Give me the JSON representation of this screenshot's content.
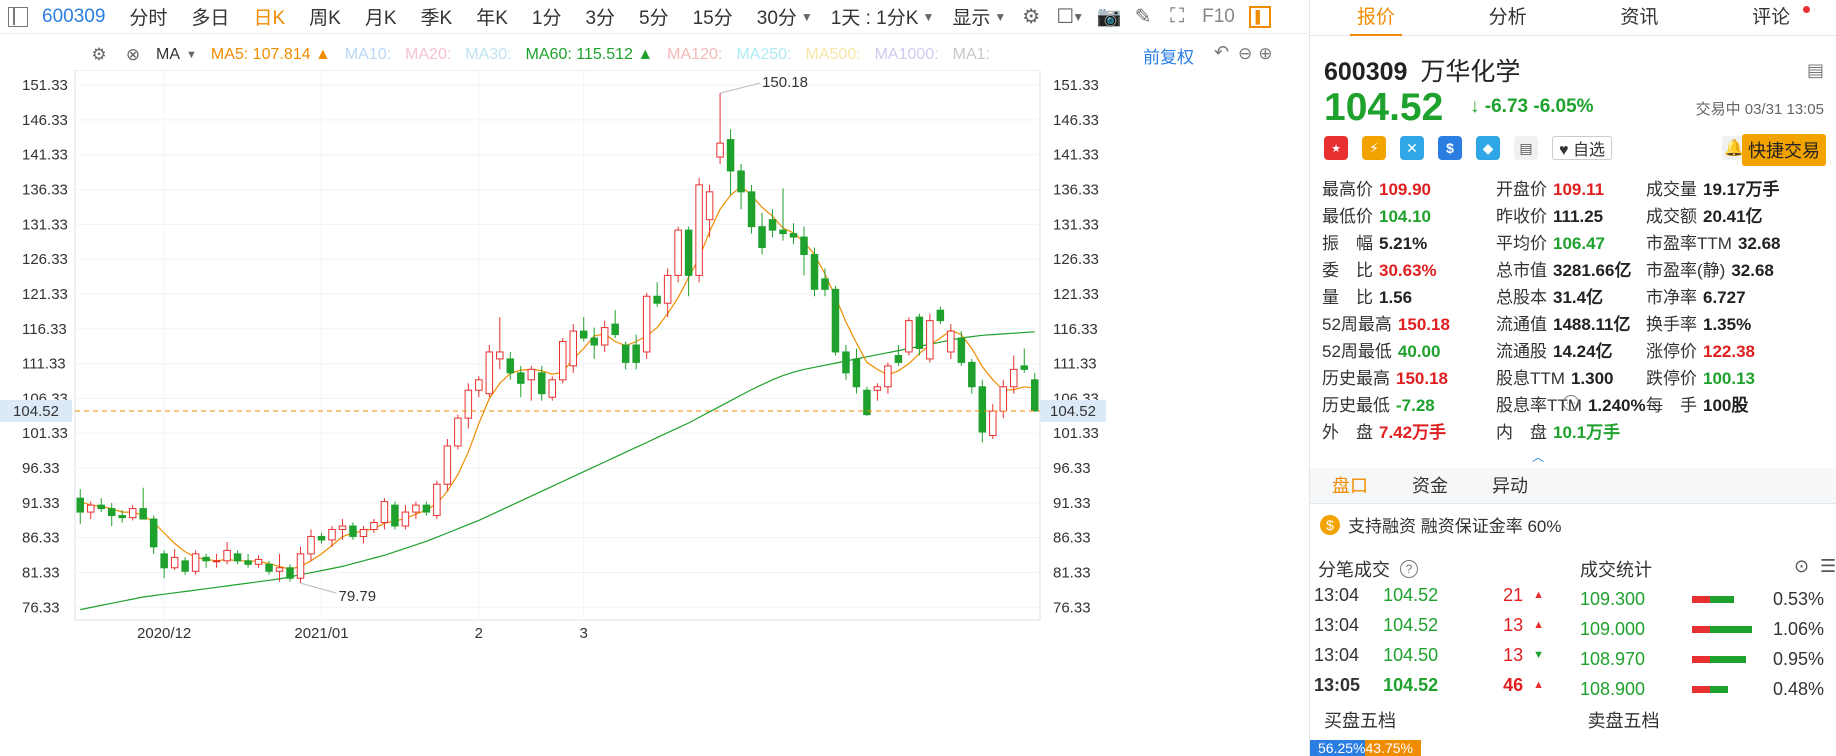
{
  "toolbar": {
    "code": "600309",
    "periods": [
      "分时",
      "多日",
      "日K",
      "周K",
      "月K",
      "季K",
      "年K",
      "1分",
      "3分",
      "5分",
      "15分",
      "30分"
    ],
    "active_period": "日K",
    "interval_select": "1天 : 1分K",
    "display_label": "显示",
    "f10_label": "F10"
  },
  "ma_row": {
    "label": "MA",
    "items": [
      {
        "text": "MA5: 107.814 ▲",
        "color": "#f08c00"
      },
      {
        "text": "MA10:",
        "color": "#b9d7f5"
      },
      {
        "text": "MA20:",
        "color": "#f4c2d8"
      },
      {
        "text": "MA30:",
        "color": "#bfe3ef"
      },
      {
        "text": "MA60: 115.512 ▲",
        "color": "#1fa12d"
      },
      {
        "text": "MA120:",
        "color": "#f5b8b8"
      },
      {
        "text": "MA250:",
        "color": "#aeeaf5"
      },
      {
        "text": "MA500:",
        "color": "#f5e6a8"
      },
      {
        "text": "MA1000:",
        "color": "#d4c8f0"
      },
      {
        "text": "MA1:",
        "color": "#c8c8c8"
      }
    ],
    "adjust_label": "前复权"
  },
  "chart_data": {
    "type": "candlestick",
    "y_ticks": [
      "151.33",
      "146.33",
      "141.33",
      "136.33",
      "131.33",
      "126.33",
      "121.33",
      "116.33",
      "111.33",
      "106.33",
      "101.33",
      "96.33",
      "91.33",
      "86.33",
      "81.33",
      "76.33"
    ],
    "ylim": [
      74.5,
      153.5
    ],
    "x_labels": [
      {
        "text": "2020/12",
        "index": 8
      },
      {
        "text": "2021/01",
        "index": 23
      },
      {
        "text": "2",
        "index": 38
      },
      {
        "text": "3",
        "index": 48
      }
    ],
    "current_price_label": "104.52",
    "current_price": 104.52,
    "high_annotation": "150.18",
    "low_annotation": "79.79",
    "candles": [
      {
        "o": 92.0,
        "h": 93.3,
        "l": 88.3,
        "c": 90.0
      },
      {
        "o": 90.0,
        "h": 91.5,
        "l": 89.0,
        "c": 91.0
      },
      {
        "o": 91.0,
        "h": 92.0,
        "l": 90.0,
        "c": 90.5
      },
      {
        "o": 90.5,
        "h": 91.3,
        "l": 88.0,
        "c": 89.5
      },
      {
        "o": 89.5,
        "h": 90.3,
        "l": 88.5,
        "c": 89.2
      },
      {
        "o": 89.2,
        "h": 91.0,
        "l": 88.8,
        "c": 90.5
      },
      {
        "o": 90.5,
        "h": 93.5,
        "l": 89.0,
        "c": 89.0
      },
      {
        "o": 89.0,
        "h": 89.5,
        "l": 84.0,
        "c": 85.0
      },
      {
        "o": 84.0,
        "h": 84.5,
        "l": 80.5,
        "c": 82.0
      },
      {
        "o": 82.0,
        "h": 84.7,
        "l": 81.7,
        "c": 83.5
      },
      {
        "o": 83.0,
        "h": 83.5,
        "l": 81.0,
        "c": 81.5
      },
      {
        "o": 81.5,
        "h": 84.5,
        "l": 81.0,
        "c": 84.0
      },
      {
        "o": 83.5,
        "h": 84.0,
        "l": 82.0,
        "c": 83.0
      },
      {
        "o": 83.0,
        "h": 84.0,
        "l": 82.0,
        "c": 83.0
      },
      {
        "o": 83.0,
        "h": 85.7,
        "l": 82.5,
        "c": 84.5
      },
      {
        "o": 84.0,
        "h": 84.5,
        "l": 82.5,
        "c": 83.0
      },
      {
        "o": 83.0,
        "h": 84.0,
        "l": 82.0,
        "c": 82.5
      },
      {
        "o": 82.5,
        "h": 83.8,
        "l": 82.0,
        "c": 83.2
      },
      {
        "o": 82.5,
        "h": 83.0,
        "l": 81.0,
        "c": 81.5
      },
      {
        "o": 81.5,
        "h": 84.0,
        "l": 80.0,
        "c": 82.0
      },
      {
        "o": 82.0,
        "h": 82.5,
        "l": 80.0,
        "c": 80.5
      },
      {
        "o": 80.5,
        "h": 85.0,
        "l": 79.8,
        "c": 84.0
      },
      {
        "o": 84.0,
        "h": 87.5,
        "l": 83.0,
        "c": 86.5
      },
      {
        "o": 86.5,
        "h": 87.0,
        "l": 85.5,
        "c": 86.0
      },
      {
        "o": 86.0,
        "h": 88.0,
        "l": 85.0,
        "c": 87.5
      },
      {
        "o": 87.5,
        "h": 89.0,
        "l": 86.0,
        "c": 88.0
      },
      {
        "o": 88.0,
        "h": 88.5,
        "l": 86.0,
        "c": 86.5
      },
      {
        "o": 86.5,
        "h": 88.0,
        "l": 85.5,
        "c": 87.5
      },
      {
        "o": 87.5,
        "h": 89.0,
        "l": 87.0,
        "c": 88.5
      },
      {
        "o": 88.5,
        "h": 92.0,
        "l": 87.5,
        "c": 91.5
      },
      {
        "o": 91.0,
        "h": 91.5,
        "l": 87.5,
        "c": 88.0
      },
      {
        "o": 88.0,
        "h": 91.0,
        "l": 87.5,
        "c": 90.0
      },
      {
        "o": 90.0,
        "h": 91.5,
        "l": 89.0,
        "c": 91.0
      },
      {
        "o": 91.0,
        "h": 91.5,
        "l": 89.5,
        "c": 90.0
      },
      {
        "o": 89.5,
        "h": 94.5,
        "l": 89.0,
        "c": 94.0
      },
      {
        "o": 94.0,
        "h": 100.5,
        "l": 93.0,
        "c": 99.5
      },
      {
        "o": 99.5,
        "h": 104.0,
        "l": 99.0,
        "c": 103.5
      },
      {
        "o": 103.5,
        "h": 108.5,
        "l": 102.0,
        "c": 107.5
      },
      {
        "o": 107.5,
        "h": 109.5,
        "l": 106.5,
        "c": 109.0
      },
      {
        "o": 107.0,
        "h": 114.0,
        "l": 106.5,
        "c": 113.0
      },
      {
        "o": 112.0,
        "h": 118.0,
        "l": 110.5,
        "c": 113.0
      },
      {
        "o": 112.0,
        "h": 113.0,
        "l": 109.0,
        "c": 110.0
      },
      {
        "o": 110.0,
        "h": 111.0,
        "l": 106.5,
        "c": 108.5
      },
      {
        "o": 109.0,
        "h": 111.0,
        "l": 106.0,
        "c": 110.5
      },
      {
        "o": 110.0,
        "h": 111.0,
        "l": 106.0,
        "c": 107.0
      },
      {
        "o": 106.5,
        "h": 109.5,
        "l": 106.0,
        "c": 109.0
      },
      {
        "o": 109.0,
        "h": 115.0,
        "l": 108.5,
        "c": 114.5
      },
      {
        "o": 111.0,
        "h": 117.0,
        "l": 110.0,
        "c": 116.0
      },
      {
        "o": 116.0,
        "h": 118.0,
        "l": 114.5,
        "c": 115.0
      },
      {
        "o": 115.0,
        "h": 116.5,
        "l": 112.0,
        "c": 114.0
      },
      {
        "o": 114.0,
        "h": 117.5,
        "l": 113.0,
        "c": 116.5
      },
      {
        "o": 117.0,
        "h": 119.0,
        "l": 115.0,
        "c": 115.5
      },
      {
        "o": 114.0,
        "h": 114.5,
        "l": 110.5,
        "c": 111.5
      },
      {
        "o": 114.0,
        "h": 115.5,
        "l": 110.5,
        "c": 111.5
      },
      {
        "o": 113.0,
        "h": 121.5,
        "l": 112.0,
        "c": 121.0
      },
      {
        "o": 121.0,
        "h": 123.0,
        "l": 119.5,
        "c": 120.0
      },
      {
        "o": 120.0,
        "h": 125.0,
        "l": 118.0,
        "c": 124.0
      },
      {
        "o": 124.0,
        "h": 131.0,
        "l": 123.0,
        "c": 130.5
      },
      {
        "o": 130.5,
        "h": 131.0,
        "l": 121.0,
        "c": 124.0
      },
      {
        "o": 124.0,
        "h": 138.0,
        "l": 123.0,
        "c": 137.0
      },
      {
        "o": 132.0,
        "h": 137.0,
        "l": 129.5,
        "c": 136.0
      },
      {
        "o": 141.0,
        "h": 150.18,
        "l": 140.0,
        "c": 143.0
      },
      {
        "o": 143.5,
        "h": 145.0,
        "l": 135.5,
        "c": 139.0
      },
      {
        "o": 139.0,
        "h": 140.0,
        "l": 133.5,
        "c": 136.0
      },
      {
        "o": 136.0,
        "h": 137.0,
        "l": 130.0,
        "c": 131.0
      },
      {
        "o": 131.0,
        "h": 133.0,
        "l": 127.0,
        "c": 128.0
      },
      {
        "o": 132.0,
        "h": 133.5,
        "l": 129.5,
        "c": 130.5
      },
      {
        "o": 130.5,
        "h": 136.5,
        "l": 129.0,
        "c": 130.0
      },
      {
        "o": 130.0,
        "h": 131.5,
        "l": 128.5,
        "c": 129.5
      },
      {
        "o": 129.5,
        "h": 131.0,
        "l": 124.0,
        "c": 127.0
      },
      {
        "o": 127.0,
        "h": 128.0,
        "l": 121.0,
        "c": 122.0
      },
      {
        "o": 123.5,
        "h": 125.0,
        "l": 121.0,
        "c": 122.0
      },
      {
        "o": 122.0,
        "h": 122.5,
        "l": 112.5,
        "c": 113.0
      },
      {
        "o": 113.0,
        "h": 114.0,
        "l": 109.0,
        "c": 110.0
      },
      {
        "o": 112.0,
        "h": 113.5,
        "l": 107.0,
        "c": 108.0
      },
      {
        "o": 107.5,
        "h": 108.0,
        "l": 103.8,
        "c": 104.0
      },
      {
        "o": 107.5,
        "h": 108.5,
        "l": 106.0,
        "c": 108.0
      },
      {
        "o": 108.0,
        "h": 111.5,
        "l": 107.0,
        "c": 111.0
      },
      {
        "o": 112.5,
        "h": 114.0,
        "l": 111.0,
        "c": 111.5
      },
      {
        "o": 113.0,
        "h": 118.0,
        "l": 112.5,
        "c": 117.5
      },
      {
        "o": 118.0,
        "h": 118.5,
        "l": 112.5,
        "c": 113.5
      },
      {
        "o": 112.0,
        "h": 118.5,
        "l": 111.5,
        "c": 117.5
      },
      {
        "o": 119.0,
        "h": 119.5,
        "l": 117.0,
        "c": 117.5
      },
      {
        "o": 113.0,
        "h": 117.0,
        "l": 112.0,
        "c": 116.0
      },
      {
        "o": 115.0,
        "h": 116.0,
        "l": 111.0,
        "c": 111.5
      },
      {
        "o": 111.5,
        "h": 112.0,
        "l": 107.0,
        "c": 108.0
      },
      {
        "o": 108.0,
        "h": 109.0,
        "l": 100.0,
        "c": 101.5
      },
      {
        "o": 101.0,
        "h": 105.5,
        "l": 100.5,
        "c": 104.5
      },
      {
        "o": 104.5,
        "h": 109.0,
        "l": 103.5,
        "c": 108.0
      },
      {
        "o": 108.0,
        "h": 112.5,
        "l": 107.0,
        "c": 110.5
      },
      {
        "o": 111.0,
        "h": 113.5,
        "l": 110.0,
        "c": 110.5
      },
      {
        "o": 109.0,
        "h": 110.0,
        "l": 104.4,
        "c": 104.52
      }
    ],
    "ma5": [
      91.5,
      91.0,
      90.8,
      90.5,
      90.0,
      90.0,
      89.5,
      88.5,
      87.0,
      85.5,
      84.3,
      83.5,
      83.2,
      83.0,
      83.2,
      83.0,
      83.0,
      82.9,
      82.6,
      82.2,
      81.8,
      82.2,
      83.0,
      84.0,
      85.2,
      86.5,
      87.0,
      87.3,
      87.6,
      88.4,
      88.7,
      89.1,
      89.7,
      90.3,
      91.2,
      93.0,
      95.4,
      98.6,
      102.7,
      106.3,
      108.5,
      109.9,
      110.4,
      110.5,
      110.3,
      109.8,
      110.1,
      112.0,
      113.5,
      115.3,
      115.6,
      114.5,
      113.9,
      114.5,
      115.3,
      116.5,
      118.5,
      120.8,
      123.7,
      126.5,
      130.3,
      133.5,
      135.5,
      136.8,
      135.5,
      133.8,
      132.5,
      130.8,
      130.1,
      128.8,
      127.0,
      124.2,
      120.9,
      117.3,
      114.3,
      111.5,
      110.5,
      109.7,
      110.3,
      111.3,
      112.8,
      114.0,
      115.0,
      116.1,
      115.5,
      113.5,
      110.9,
      109.0,
      107.5,
      107.6,
      108.0,
      107.8
    ],
    "ma60": [
      76.0,
      76.3,
      76.6,
      76.9,
      77.2,
      77.5,
      77.8,
      78.0,
      78.2,
      78.4,
      78.6,
      78.8,
      79.0,
      79.2,
      79.4,
      79.6,
      79.8,
      80.0,
      80.2,
      80.4,
      80.7,
      81.0,
      81.3,
      81.6,
      81.9,
      82.2,
      82.6,
      83.0,
      83.4,
      83.8,
      84.3,
      84.8,
      85.3,
      85.8,
      86.4,
      87.0,
      87.6,
      88.2,
      88.8,
      89.5,
      90.2,
      90.9,
      91.6,
      92.3,
      93.0,
      93.7,
      94.4,
      95.1,
      95.8,
      96.5,
      97.2,
      97.9,
      98.6,
      99.3,
      100.0,
      100.7,
      101.4,
      102.1,
      102.8,
      103.6,
      104.4,
      105.2,
      106.0,
      106.8,
      107.6,
      108.3,
      109.0,
      109.6,
      110.1,
      110.5,
      110.8,
      111.1,
      111.4,
      111.7,
      112.0,
      112.3,
      112.6,
      112.9,
      113.2,
      113.5,
      113.8,
      114.1,
      114.4,
      114.7,
      115.0,
      115.2,
      115.4,
      115.5,
      115.6,
      115.7,
      115.8,
      115.9
    ]
  },
  "right_tabs": [
    "报价",
    "分析",
    "资讯",
    "评论"
  ],
  "stock": {
    "code": "600309",
    "name": "万华化学",
    "price": "104.52",
    "arrow": "↓",
    "change": "-6.73",
    "change_pct": "-6.05%",
    "status_time": "交易中 03/31 13:05",
    "watch_label": "♥ 自选",
    "quick_trade": "快捷交易"
  },
  "stats": [
    [
      {
        "label": "最高价",
        "value": "109.90",
        "tone": "red"
      },
      {
        "label": "开盘价",
        "value": "109.11",
        "tone": "red"
      },
      {
        "label": "成交量",
        "value": "19.17万手",
        "tone": "dark"
      }
    ],
    [
      {
        "label": "最低价",
        "value": "104.10",
        "tone": "green"
      },
      {
        "label": "昨收价",
        "value": "111.25",
        "tone": "dark"
      },
      {
        "label": "成交额",
        "value": "20.41亿",
        "tone": "dark"
      }
    ],
    [
      {
        "label": "振　幅",
        "value": "5.21%",
        "tone": "dark"
      },
      {
        "label": "平均价",
        "value": "106.47",
        "tone": "green"
      },
      {
        "label": "市盈率TTM",
        "value": "32.68",
        "tone": "dark"
      }
    ],
    [
      {
        "label": "委　比",
        "value": "30.63%",
        "tone": "red"
      },
      {
        "label": "总市值",
        "value": "3281.66亿",
        "tone": "dark"
      },
      {
        "label": "市盈率(静)",
        "value": "32.68",
        "tone": "dark"
      }
    ],
    [
      {
        "label": "量　比",
        "value": "1.56",
        "tone": "dark"
      },
      {
        "label": "总股本",
        "value": "31.4亿",
        "tone": "dark"
      },
      {
        "label": "市净率",
        "value": "6.727",
        "tone": "dark"
      }
    ],
    [
      {
        "label": "52周最高",
        "value": "150.18",
        "tone": "red"
      },
      {
        "label": "流通值",
        "value": "1488.11亿",
        "tone": "dark"
      },
      {
        "label": "换手率",
        "value": "1.35%",
        "tone": "dark"
      }
    ],
    [
      {
        "label": "52周最低",
        "value": "40.00",
        "tone": "green"
      },
      {
        "label": "流通股",
        "value": "14.24亿",
        "tone": "dark"
      },
      {
        "label": "涨停价",
        "value": "122.38",
        "tone": "red"
      }
    ],
    [
      {
        "label": "历史最高",
        "value": "150.18",
        "tone": "red"
      },
      {
        "label": "股息TTM",
        "value": "1.300",
        "tone": "dark"
      },
      {
        "label": "跌停价",
        "value": "100.13",
        "tone": "green"
      }
    ],
    [
      {
        "label": "历史最低",
        "value": "-7.28",
        "tone": "green"
      },
      {
        "label": "股息率TTM",
        "value": "1.240%",
        "tone": "dark"
      },
      {
        "label": "每　手",
        "value": "100股",
        "tone": "dark"
      }
    ],
    [
      {
        "label": "外　盘",
        "value": "7.42万手",
        "tone": "red"
      },
      {
        "label": "内　盘",
        "value": "10.1万手",
        "tone": "green"
      },
      {
        "label": "",
        "value": "",
        "tone": "dark"
      }
    ]
  ],
  "mid_tabs": [
    "盘口",
    "资金",
    "异动"
  ],
  "margin_note": "支持融资 融资保证金率 60%",
  "trades": {
    "title": "分笔成交",
    "rows": [
      {
        "time": "13:04",
        "price": "104.52",
        "vol": "21",
        "dir": "up"
      },
      {
        "time": "13:04",
        "price": "104.52",
        "vol": "13",
        "dir": "up"
      },
      {
        "time": "13:04",
        "price": "104.50",
        "vol": "13",
        "dir": "down"
      },
      {
        "time": "13:05",
        "price": "104.52",
        "vol": "46",
        "dir": "up"
      }
    ]
  },
  "deal_stats": {
    "title": "成交统计",
    "rows": [
      {
        "price": "109.300",
        "pct": "0.53%",
        "red": 0.3,
        "green": 0.4
      },
      {
        "price": "109.000",
        "pct": "1.06%",
        "red": 0.3,
        "green": 0.7
      },
      {
        "price": "108.970",
        "pct": "0.95%",
        "red": 0.3,
        "green": 0.6
      },
      {
        "price": "108.900",
        "pct": "0.48%",
        "red": 0.3,
        "green": 0.3
      }
    ]
  },
  "book": {
    "buy_title": "买盘五档",
    "sell_title": "卖盘五档",
    "buy_pct": "56.25%",
    "sell_pct": "43.75%"
  },
  "colors": {
    "up": "#e93030",
    "down": "#1fa12d",
    "ma5": "#f08c00",
    "ma60": "#1fa12d",
    "accent": "#f08c00"
  }
}
